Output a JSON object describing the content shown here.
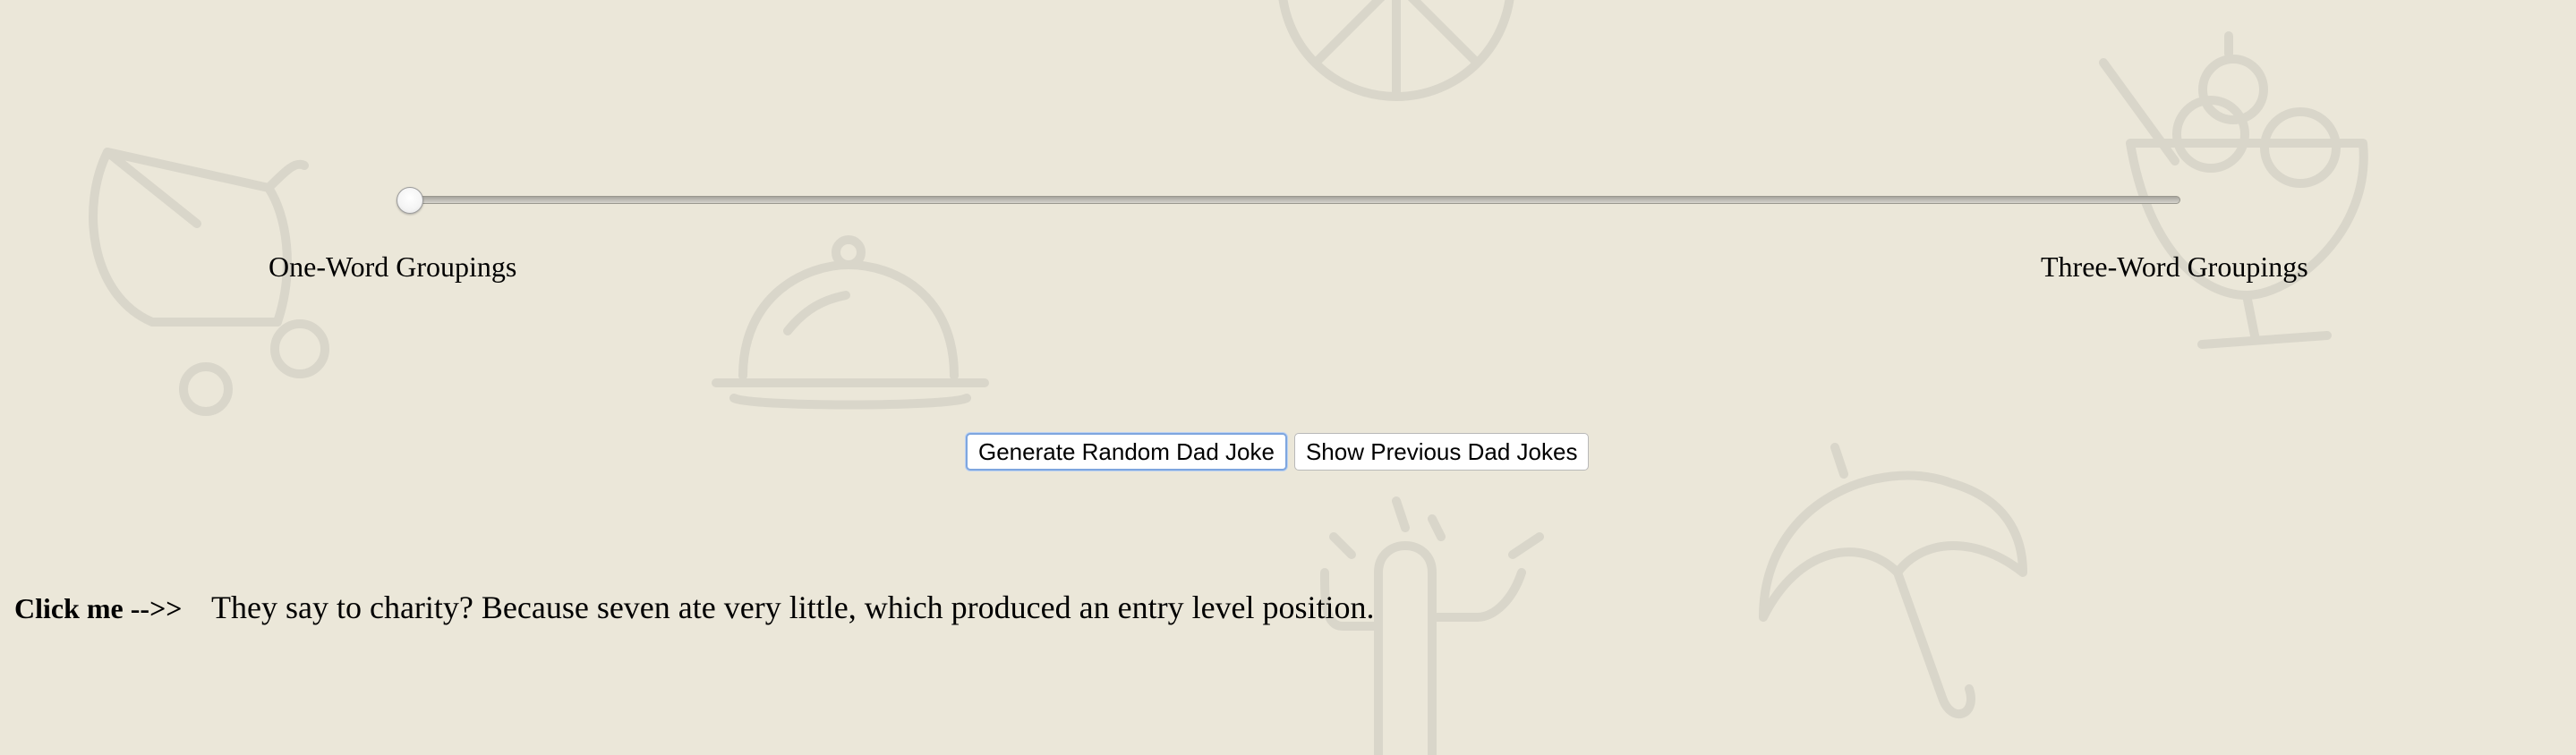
{
  "slider": {
    "left_label": "One-Word Groupings",
    "right_label": "Three-Word Groupings",
    "value_fraction": 0
  },
  "buttons": {
    "generate_label": "Generate Random Dad Joke",
    "previous_label": "Show Previous Dad Jokes"
  },
  "joke": {
    "click_me": "Click me -->>",
    "text": "They say to charity? Because seven ate very little, which produced an entry level position."
  },
  "colors": {
    "background": "#ebe7d9",
    "background_art": "#d9d6ca",
    "focus_ring": "#7ea6df"
  },
  "background_icons": [
    "stroller-icon",
    "food-cloche-icon",
    "peace-sign-icon",
    "cactus-icon",
    "umbrella-icon",
    "ice-cream-sundae-icon"
  ]
}
